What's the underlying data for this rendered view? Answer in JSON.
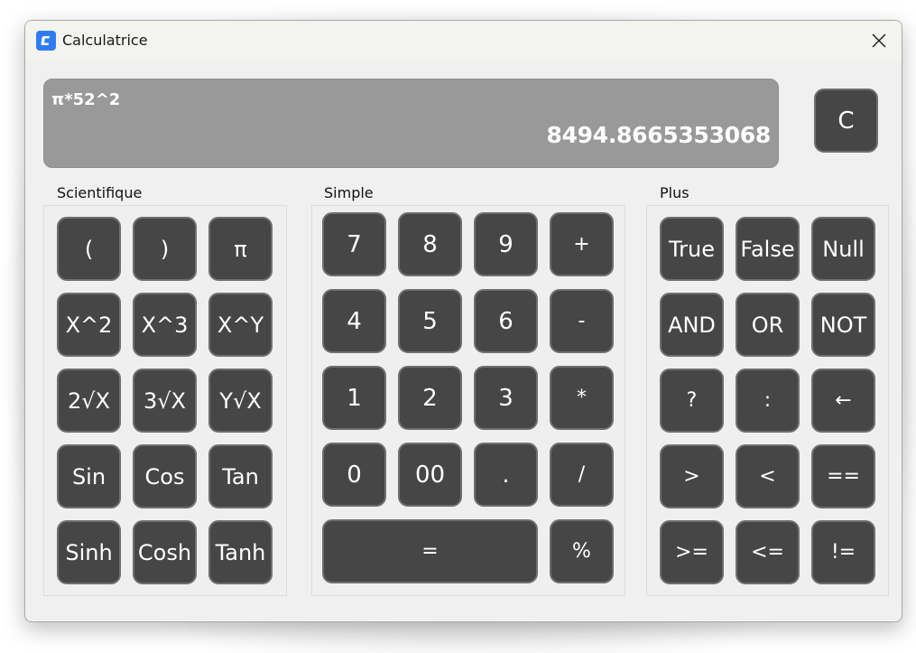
{
  "window": {
    "title": "Calculatrice",
    "app_icon": "calculator-app-icon",
    "close_icon": "close-icon"
  },
  "display": {
    "expression": "π*52^2",
    "result": "8494.8665353068"
  },
  "clear_button": {
    "label": "C"
  },
  "sections": {
    "scientific": {
      "label": "Scientifique",
      "buttons": [
        "(",
        ")",
        "π",
        "X^2",
        "X^3",
        "X^Y",
        "2√X",
        "3√X",
        "Y√X",
        "Sin",
        "Cos",
        "Tan",
        "Sinh",
        "Cosh",
        "Tanh"
      ]
    },
    "simple": {
      "label": "Simple",
      "buttons": [
        "7",
        "8",
        "9",
        "+",
        "4",
        "5",
        "6",
        "-",
        "1",
        "2",
        "3",
        "*",
        "0",
        "00",
        ".",
        "/",
        "=",
        "%"
      ]
    },
    "plus": {
      "label": "Plus",
      "buttons": [
        "True",
        "False",
        "Null",
        "AND",
        "OR",
        "NOT",
        "?",
        ":",
        "←",
        ">",
        "<",
        "==",
        ">=",
        "<=",
        "!="
      ]
    }
  },
  "colors": {
    "button_bg": "#464646",
    "button_border": "#6f6f6f",
    "display_bg": "#999999",
    "window_bg": "#f0f0f0",
    "app_icon": "#2f7cf0"
  }
}
